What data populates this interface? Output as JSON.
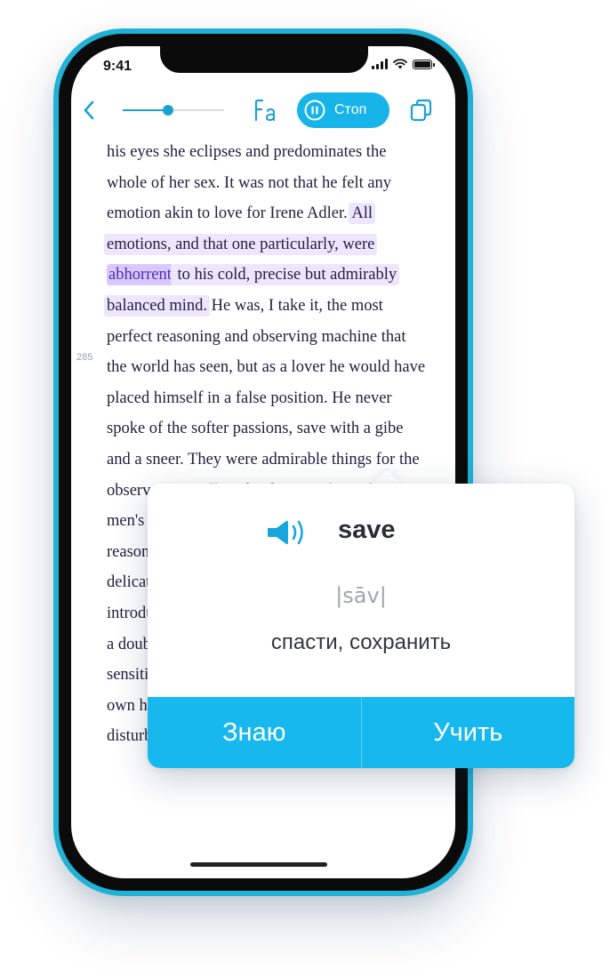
{
  "status_bar": {
    "time": "9:41"
  },
  "toolbar": {
    "progress": 0.45,
    "stop_label": "Стоп",
    "accent_color": "#17b4ea"
  },
  "book": {
    "page_number": "285",
    "segments": [
      {
        "text": "his eyes she eclipses and predominates the whole of her sex. It was not that he felt any emotion akin to love for Irene Adler. ",
        "style": "normal"
      },
      {
        "text": "All emotions, and that one particularly, were ",
        "style": "highlight"
      },
      {
        "text": "abhorrent",
        "style": "word"
      },
      {
        "text": " to his cold, precise but admirably balanced mind.",
        "style": "highlight"
      },
      {
        "text": " He was, I take it, the most perfect reasoning and observing machine that the world has seen, but as a lover he would have placed himself in a false position. He never spoke of the softer passions, save with a gibe and a sneer. They were admirable things for the observer—excellent for drawing the veil from men's motives and actions. But for the trained reasoner to admit such intrusions into his own delicate and finely adjusted temperament was to introduce a distracting factor which might throw a doubt upon all his mental results. Grit in a sensitive instrument, or a crack in one of his own high-power lenses, would not be more disturbing than a strong",
        "style": "normal"
      }
    ],
    "highlight_color": "#ede6ff",
    "word_highlight_color": "#d9c8ff"
  },
  "popup": {
    "word": "save",
    "transcription": "|sāv|",
    "translation": "спасти, сохранить",
    "know_button": "Знаю",
    "learn_button": "Учить",
    "button_color": "#17b8ed"
  }
}
